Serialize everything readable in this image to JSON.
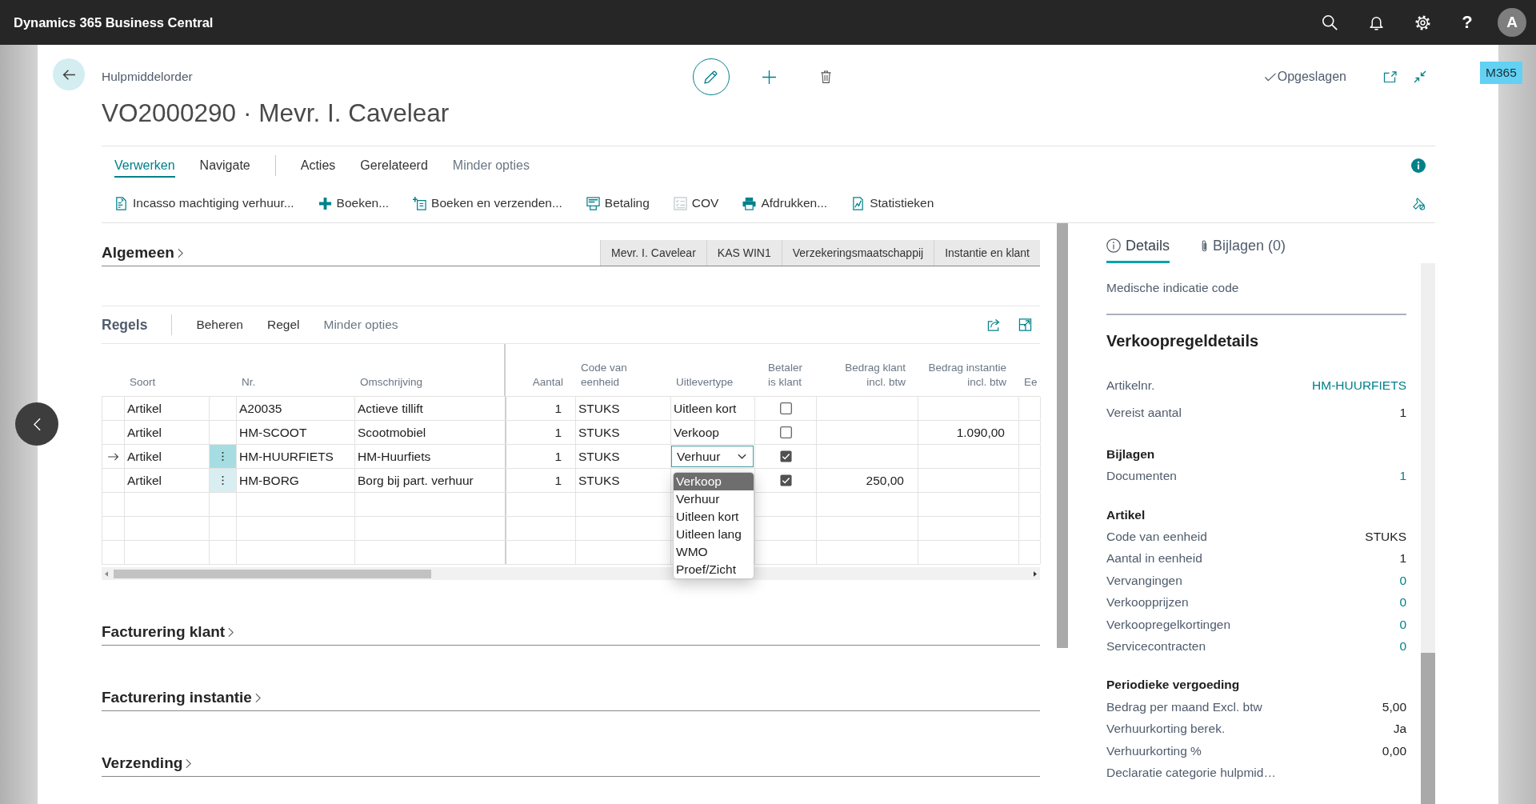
{
  "top_bar": {
    "title": "Dynamics 365 Business Central",
    "help": "?",
    "avatar": "A"
  },
  "badge": "M365",
  "header": {
    "breadcrumb": "Hulpmiddelorder",
    "title": "VO2000290 · Mevr. I. Cavelear",
    "status": "Opgeslagen"
  },
  "action_bar": {
    "groups": [
      [
        {
          "label": "Verwerken",
          "selected": true
        },
        {
          "label": "Navigate",
          "selected": false
        }
      ],
      [
        {
          "label": "Acties",
          "selected": false
        },
        {
          "label": "Gerelateerd",
          "selected": false
        }
      ]
    ],
    "toggle": "Minder opties",
    "actions": [
      "Incasso machtiging verhuur...",
      "Boeken...",
      "Boeken en verzenden...",
      "Betaling",
      "COV",
      "Afdrukken...",
      "Statistieken"
    ]
  },
  "general": {
    "title": "Algemeen",
    "chips": [
      "Mevr. I. Cavelear",
      "KAS WIN1",
      "Verzekeringsmaatschappij",
      "Instantie en klant"
    ]
  },
  "lines": {
    "title": "Regels",
    "menu": [
      "Beheren",
      "Regel"
    ],
    "toggle": "Minder opties",
    "columns": [
      "Soort",
      "Nr.",
      "Omschrijving",
      "Aantal",
      "Code van\neenheid",
      "Uitlevertype",
      "Betaler\nis klant",
      "Bedrag klant\nincl. btw",
      "Bedrag instantie\nincl. btw",
      "Ee"
    ],
    "rows": [
      {
        "selected": false,
        "hovered": false,
        "editing": false,
        "type": "Artikel",
        "no": "A20035",
        "description": "Actieve tillift",
        "quantity": "1",
        "unit": "STUKS",
        "delivery_type": "Uitleen kort",
        "payer_is_customer": false
      },
      {
        "selected": false,
        "hovered": false,
        "editing": false,
        "type": "Artikel",
        "no": "HM-SCOOT",
        "description": "Scootmobiel",
        "quantity": "1",
        "unit": "STUKS",
        "delivery_type": "Verkoop",
        "payer_is_customer": false,
        "amount_agency": "1.090,00"
      },
      {
        "selected": true,
        "hovered": false,
        "editing": true,
        "type": "Artikel",
        "no": "HM-HUURFIETS",
        "description": "HM-Huurfiets",
        "quantity": "1",
        "unit": "STUKS",
        "delivery_type": "Verhuur",
        "payer_is_customer": true,
        "options": [
          {
            "label": "Verkoop",
            "selected": true
          },
          {
            "label": "Verhuur",
            "selected": false
          },
          {
            "label": "Uitleen kort",
            "selected": false
          },
          {
            "label": "Uitleen lang",
            "selected": false
          },
          {
            "label": "WMO",
            "selected": false
          },
          {
            "label": "Proef/Zicht",
            "selected": false
          }
        ]
      },
      {
        "selected": false,
        "hovered": true,
        "editing": false,
        "type": "Artikel",
        "no": "HM-BORG",
        "description": "Borg bij part. verhuur",
        "quantity": "1",
        "unit": "STUKS",
        "payer_is_customer": true,
        "amount_customer": "250,00"
      }
    ]
  },
  "sections": [
    "Facturering klant",
    "Facturering instantie",
    "Verzending"
  ],
  "factbox": {
    "tabs": [
      {
        "label": "Details",
        "selected": true
      },
      {
        "label": "Bijlagen (0)",
        "selected": false
      }
    ],
    "top_fields": [
      {
        "label": "Medische indicatie code"
      }
    ],
    "title": "Verkoopregeldetails",
    "groups": [
      {
        "fields": [
          {
            "label": "Artikelnr.",
            "value": "HM-HUURFIETS",
            "link": true
          },
          {
            "label": "Vereist aantal",
            "value": "1",
            "link": false
          }
        ]
      },
      {
        "heading": "Bijlagen",
        "fields": [
          {
            "label": "Documenten",
            "value": "1",
            "link": true
          }
        ]
      },
      {
        "heading": "Artikel",
        "fields": [
          {
            "label": "Code van eenheid",
            "value": "STUKS",
            "link": false
          },
          {
            "label": "Aantal in eenheid",
            "value": "1",
            "link": false
          },
          {
            "label": "Vervangingen",
            "value": "0",
            "link": true
          },
          {
            "label": "Verkoopprijzen",
            "value": "0",
            "link": true
          },
          {
            "label": "Verkoopregelkortingen",
            "value": "0",
            "link": true
          },
          {
            "label": "Servicecontracten",
            "value": "0",
            "link": true
          }
        ]
      },
      {
        "heading": "Periodieke vergoeding",
        "fields": [
          {
            "label": "Bedrag per maand Excl. btw",
            "value": "5,00",
            "link": false
          },
          {
            "label": "Verhuurkorting berek.",
            "value": "Ja",
            "link": false
          },
          {
            "label": "Verhuurkorting %",
            "value": "0,00",
            "link": false
          },
          {
            "label": "Declaratie categorie hulpmid…"
          }
        ]
      }
    ]
  }
}
